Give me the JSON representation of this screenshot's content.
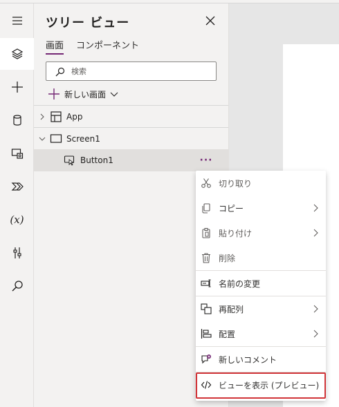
{
  "pane": {
    "title": "ツリー ビュー",
    "tabs": [
      {
        "label": "画面",
        "active": true
      },
      {
        "label": "コンポーネント",
        "active": false
      }
    ],
    "search_placeholder": "検索",
    "new_screen_label": "新しい画面"
  },
  "tree": [
    {
      "label": "App",
      "icon": "app-icon",
      "expanded": false
    },
    {
      "label": "Screen1",
      "icon": "screen-icon",
      "expanded": true
    },
    {
      "label": "Button1",
      "icon": "button-control-icon",
      "selected": true
    }
  ],
  "more_label": "···",
  "rail_items": [
    "menu-icon",
    "tree-view-icon",
    "insert-icon",
    "data-icon",
    "media-icon",
    "power-automate-icon",
    "variables-icon",
    "advanced-tools-icon",
    "search-icon"
  ],
  "rail_variables_label": "(x)",
  "context_menu": {
    "items": [
      {
        "label": "切り取り",
        "icon": "cut-icon",
        "submenu": false
      },
      {
        "label": "コピー",
        "icon": "copy-icon",
        "submenu": true
      },
      {
        "label": "貼り付け",
        "icon": "paste-icon",
        "submenu": true
      },
      {
        "label": "削除",
        "icon": "delete-icon",
        "submenu": false
      },
      {
        "label": "名前の変更",
        "icon": "rename-icon",
        "submenu": false
      },
      {
        "label": "再配列",
        "icon": "reorder-icon",
        "submenu": true
      },
      {
        "label": "配置",
        "icon": "align-icon",
        "submenu": true
      },
      {
        "label": "新しいコメント",
        "icon": "comment-icon",
        "submenu": false
      },
      {
        "label": "ビューを表示 (プレビュー)",
        "icon": "code-view-icon",
        "submenu": false,
        "highlighted": true
      }
    ]
  },
  "colors": {
    "accent": "#742774",
    "highlight_border": "#d13438",
    "pane_bg": "#f3f2f1",
    "canvas_bg": "#e6e6e6"
  }
}
